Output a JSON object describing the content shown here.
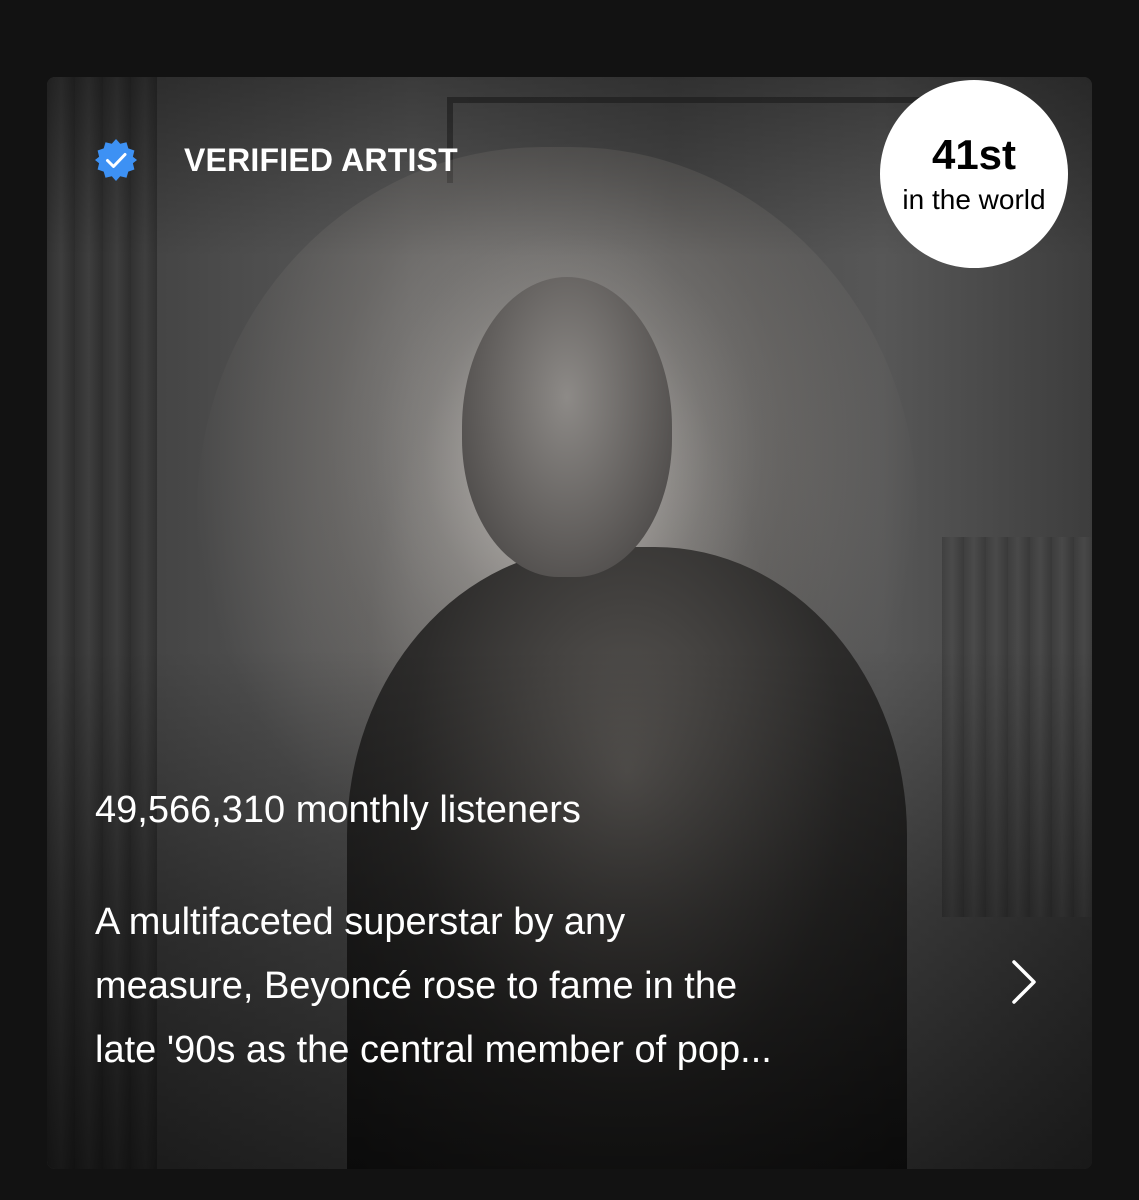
{
  "artist_card": {
    "verified_label": "VERIFIED ARTIST",
    "rank": {
      "number": "41st",
      "caption": "in the world"
    },
    "monthly_listeners": "49,566,310 monthly listeners",
    "bio_lines": [
      "A multifaceted superstar by any",
      "measure, Beyoncé rose to fame in the",
      "late '90s as the central member of pop..."
    ]
  },
  "icons": {
    "verified": "verified-badge-icon",
    "more": "chevron-right-icon"
  },
  "colors": {
    "background": "#121212",
    "verified_blue": "#3d91f4",
    "text": "#ffffff",
    "badge_bg": "#ffffff"
  }
}
